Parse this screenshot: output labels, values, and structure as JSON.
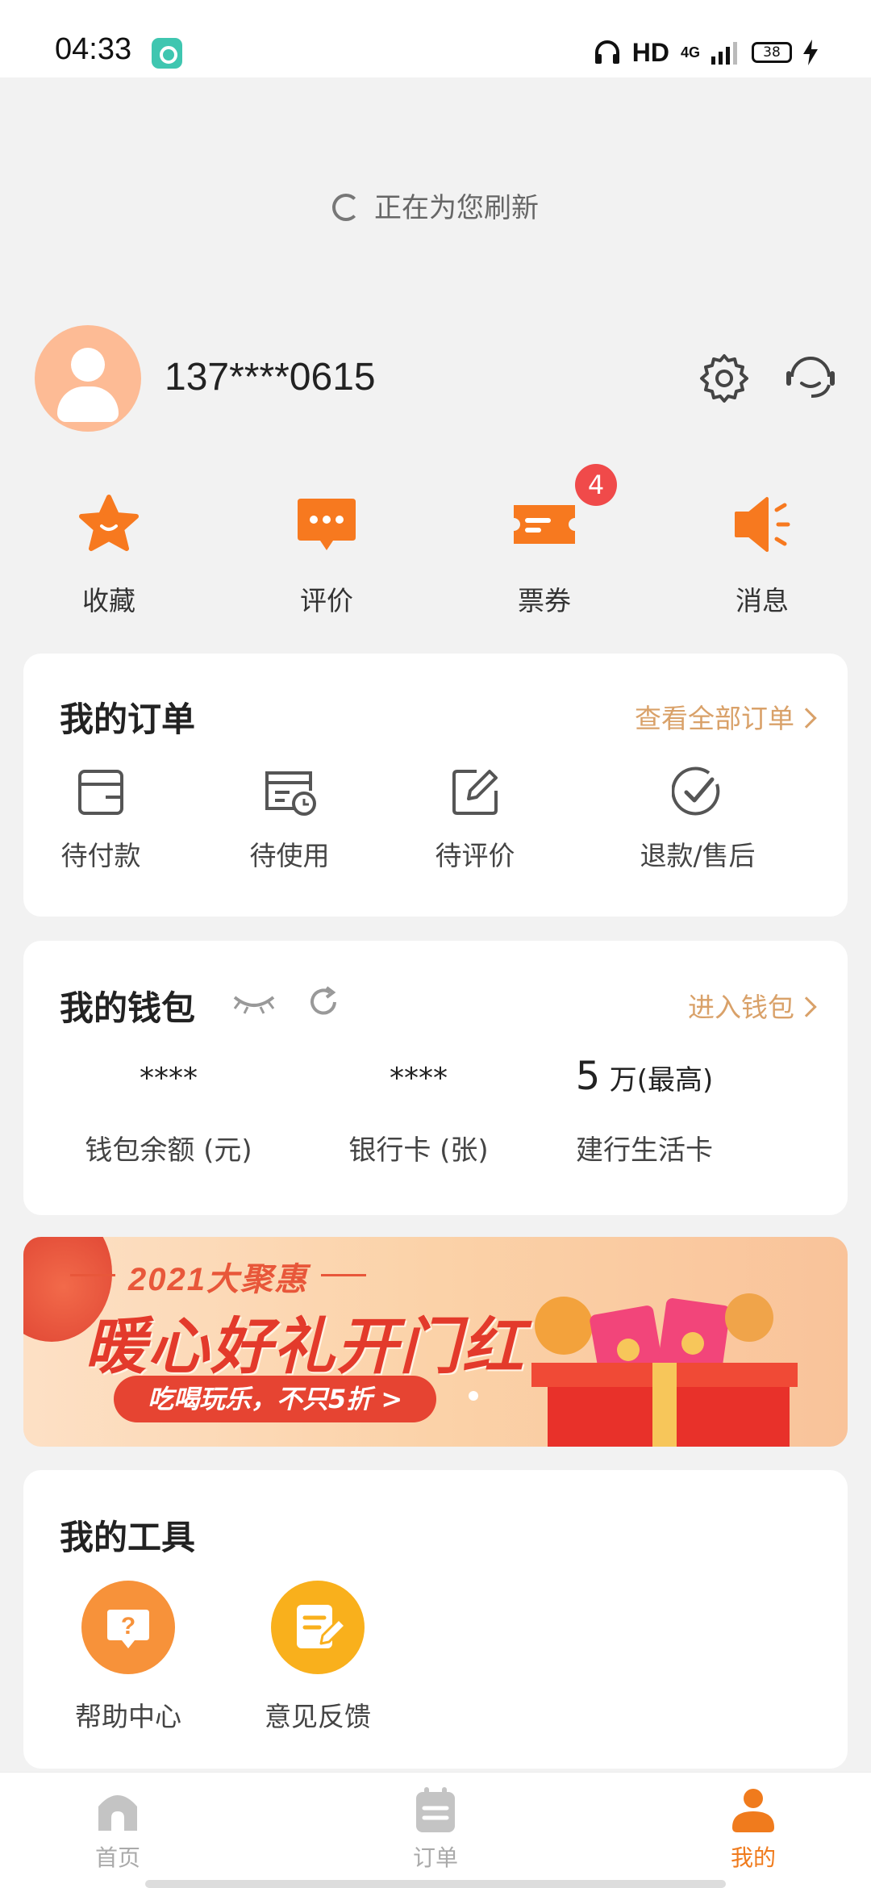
{
  "status_bar": {
    "time": "04:33",
    "network": "HD",
    "signal": "4G",
    "battery": "38"
  },
  "refresh_text": "正在为您刷新",
  "profile": {
    "phone": "137****0615"
  },
  "quick_actions": [
    {
      "label": "收藏",
      "icon": "star-icon"
    },
    {
      "label": "评价",
      "icon": "comment-icon"
    },
    {
      "label": "票券",
      "icon": "ticket-icon"
    },
    {
      "label": "消息",
      "icon": "speaker-icon"
    }
  ],
  "ticket_badge": "4",
  "orders": {
    "title": "我的订单",
    "view_all": "查看全部订单",
    "items": [
      {
        "label": "待付款",
        "icon": "wallet-card-icon"
      },
      {
        "label": "待使用",
        "icon": "calendar-clock-icon"
      },
      {
        "label": "待评价",
        "icon": "edit-icon"
      },
      {
        "label": "退款/售后",
        "icon": "check-circle-icon"
      }
    ]
  },
  "wallet": {
    "title": "我的钱包",
    "enter": "进入钱包",
    "items": [
      {
        "value": "****",
        "label": "钱包余额 (元)"
      },
      {
        "value": "****",
        "label": "银行卡 (张)"
      },
      {
        "value_num": "5",
        "value_unit": "万(最高)",
        "label": "建行生活卡"
      }
    ]
  },
  "banner": {
    "subtitle": "2021大聚惠",
    "title": "暖心好礼开门红",
    "cta": "吃喝玩乐，不只5折 >"
  },
  "tools": {
    "title": "我的工具",
    "items": [
      {
        "label": "帮助中心",
        "icon": "help-icon",
        "color": "#f7923a"
      },
      {
        "label": "意见反馈",
        "icon": "feedback-icon",
        "color": "#f9b01c"
      }
    ]
  },
  "tabbar": {
    "items": [
      {
        "label": "首页",
        "icon": "home-icon",
        "active": false
      },
      {
        "label": "订单",
        "icon": "orders-icon",
        "active": false
      },
      {
        "label": "我的",
        "icon": "profile-icon",
        "active": true
      }
    ]
  },
  "colors": {
    "accent": "#f07b1d",
    "link": "#d9a169",
    "badge": "#f04a4a"
  }
}
